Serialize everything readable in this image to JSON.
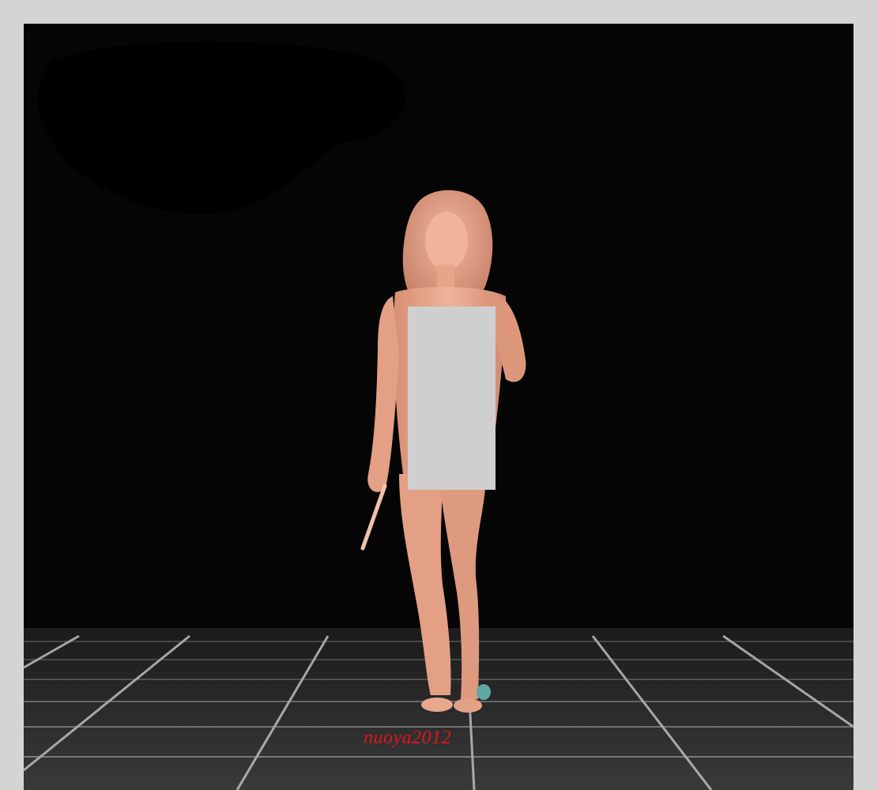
{
  "photo": {
    "subject": "figure",
    "censor_box": "censor-box",
    "watermark_text": "nuoya2012"
  },
  "colors": {
    "frame": "#d4d4d4",
    "backdrop": "#050505",
    "figure_skin": "#e8a98f",
    "censor_box": "#cfcfcf",
    "watermark": "#e0141e",
    "grid_lines": "#bdbdbd"
  }
}
